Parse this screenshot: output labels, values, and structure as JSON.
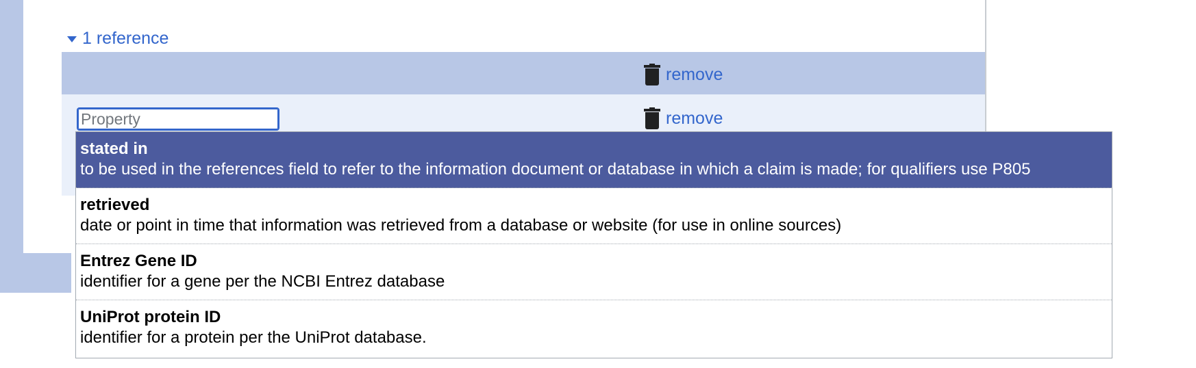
{
  "reference_section": {
    "toggle_label": "1 reference",
    "header_remove_label": "remove",
    "snak_remove_label": "remove"
  },
  "property_input": {
    "placeholder": "Property",
    "value": ""
  },
  "suggestions": [
    {
      "label": "stated in",
      "description": "to be used in the references field to refer to the information document or database in which a claim is made; for qualifiers use P805",
      "selected": true
    },
    {
      "label": "retrieved",
      "description": "date or point in time that information was retrieved from a database or website (for use in online sources)",
      "selected": false
    },
    {
      "label": "Entrez Gene ID",
      "description": "identifier for a gene per the NCBI Entrez database",
      "selected": false
    },
    {
      "label": "UniProt protein ID",
      "description": "identifier for a protein per the UniProt database.",
      "selected": false
    }
  ],
  "colors": {
    "link": "#3366cc",
    "header_band": "#b8c7e6",
    "body_band": "#eaf0fa",
    "selected_bg": "#4c5b9e"
  },
  "icons": {
    "toggle": "triangle-down-icon",
    "remove": "trash-icon"
  }
}
